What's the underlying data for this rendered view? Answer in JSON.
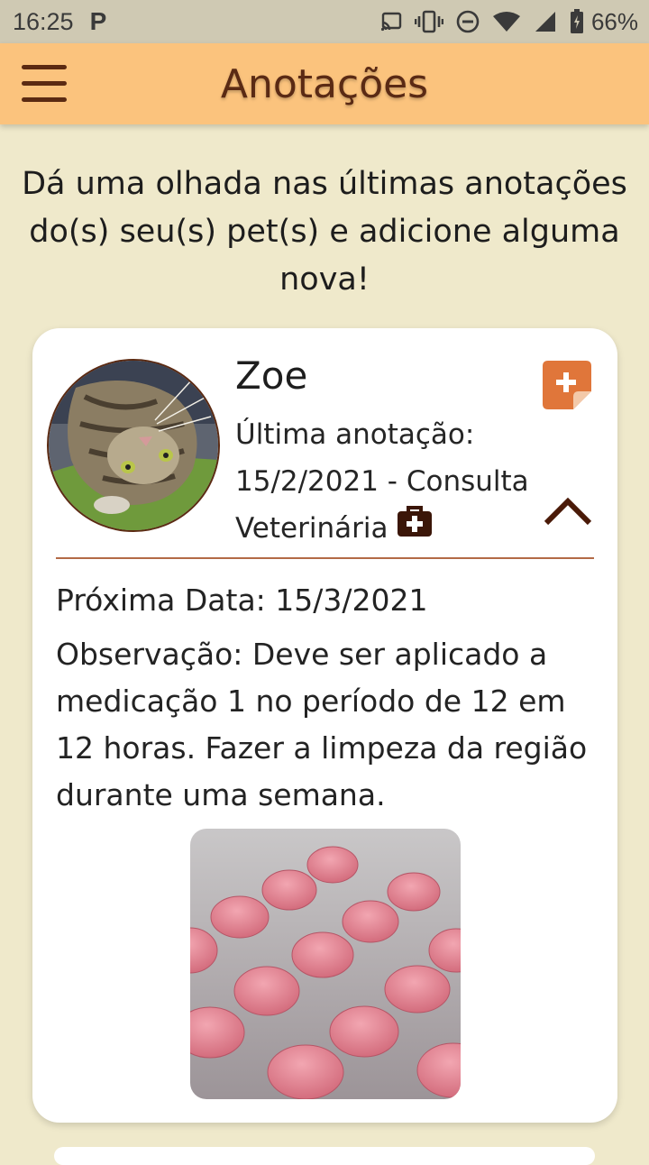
{
  "status_bar": {
    "time": "16:25",
    "notification_letter": "P",
    "battery": "66%"
  },
  "app_bar": {
    "title": "Anotações",
    "menu_icon": "hamburger-menu-icon"
  },
  "intro_text": "Dá uma olhada nas últimas anotações do(s) seu(s) pet(s) e adicione alguma nova!",
  "note_card": {
    "pet_name": "Zoe",
    "last_note_label": "Última anotação:",
    "last_note_date_type": "15/2/2021 - Consulta",
    "last_note_type_cont": "Veterinária",
    "type_icon": "medical-kit-icon",
    "add_icon": "add-note-icon",
    "collapse_icon": "chevron-up-icon",
    "next_date": "Próxima Data: 15/3/2021",
    "observation": "Observação: Deve ser aplicado a medicação 1 no período de 12 em 12 horas. Fazer a limpeza da região durante uma semana."
  },
  "colors": {
    "background": "#efe9cb",
    "app_bar": "#fbc37d",
    "accent_brown": "#5b2a12",
    "add_button": "#e0763a"
  }
}
